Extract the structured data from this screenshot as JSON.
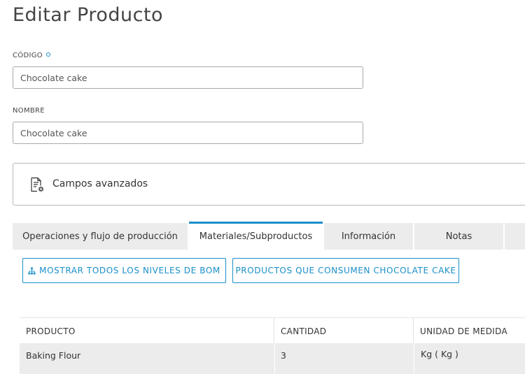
{
  "page": {
    "title": "Editar Producto"
  },
  "form": {
    "codigo": {
      "label": "CÓDIGO",
      "value": "Chocolate cake"
    },
    "nombre": {
      "label": "NOMBRE",
      "value": "Chocolate cake"
    }
  },
  "advanced": {
    "label": "Campos avanzados",
    "icon": "document-gear-icon"
  },
  "tabs": [
    {
      "label": "Operaciones y flujo de producción",
      "active": false
    },
    {
      "label": "Materiales/Subproductos",
      "active": true
    },
    {
      "label": "Información",
      "active": false
    },
    {
      "label": "Notas",
      "active": false
    }
  ],
  "actions": {
    "show_bom_levels": "MOSTRAR TODOS LOS NIVELES DE BOM",
    "consuming_products": "PRODUCTOS QUE CONSUMEN CHOCOLATE CAKE"
  },
  "table": {
    "columns": [
      "PRODUCTO",
      "CANTIDAD",
      "UNIDAD DE MEDIDA"
    ],
    "rows": [
      {
        "producto": "Baking Flour",
        "cantidad": "3",
        "unidad": "Kg ( Kg )"
      }
    ]
  },
  "colors": {
    "accent": "#1a8fc9",
    "tab_bg": "#ececec",
    "row_bg": "#ececec"
  }
}
